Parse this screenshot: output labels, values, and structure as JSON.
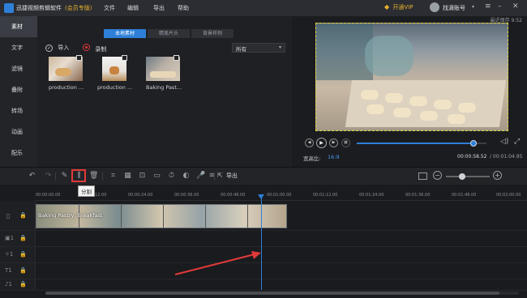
{
  "app": {
    "title": "迅捷视频剪辑软件",
    "edition": "(会员专版)",
    "menu": [
      "文件",
      "编辑",
      "导出",
      "帮助"
    ],
    "vip_label": "开通VIP",
    "account_label": "找滴账号",
    "last_save": "最近保存 9:52"
  },
  "sidebar": {
    "items": [
      {
        "label": "素材",
        "active": true
      },
      {
        "label": "文字",
        "active": false
      },
      {
        "label": "滤镜",
        "active": false
      },
      {
        "label": "叠附",
        "active": false
      },
      {
        "label": "转场",
        "active": false
      },
      {
        "label": "动画",
        "active": false
      },
      {
        "label": "配乐",
        "active": false
      }
    ]
  },
  "media": {
    "tabs": [
      {
        "label": "本地素材",
        "active": true
      },
      {
        "label": "精美片头",
        "active": false
      },
      {
        "label": "背景样例",
        "active": false
      }
    ],
    "import_label": "导入",
    "record_label": "录制",
    "filter_value": "所有",
    "items": [
      {
        "label": "production ..."
      },
      {
        "label": "production ..."
      },
      {
        "label": "Baking Past..."
      }
    ]
  },
  "preview": {
    "aspect_label": "宽高比:",
    "aspect_value": "16:9",
    "time_current": "00:00:58.52",
    "time_total": "/ 00:01:04.95",
    "progress": 0.9
  },
  "timeline_toolbar": {
    "export_label": "导出",
    "tooltip_split": "分割"
  },
  "ruler": {
    "labels": [
      "00:00:00.00",
      "00:00:12.00",
      "00:00:24.00",
      "00:00:36.00",
      "00:00:48.00",
      "00:01:00.00",
      "00:01:12.00",
      "00:01:24.00",
      "00:01:36.00",
      "00:01:48.00",
      "00:02:00.00"
    ]
  },
  "clip": {
    "title": "Baking Pastry, Breakfast"
  },
  "colors": {
    "accent": "#2e7fd8",
    "highlight": "#e23a3a",
    "vip": "#e8b22c"
  }
}
